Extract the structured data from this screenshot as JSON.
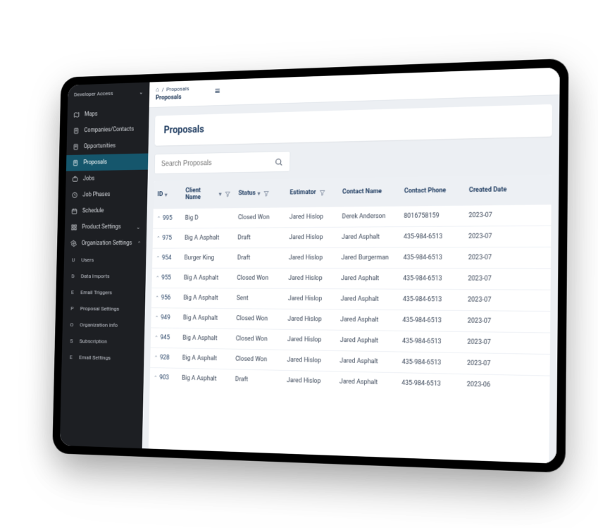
{
  "sidebar": {
    "header": {
      "label": "Developer Access"
    },
    "items": [
      {
        "key": "maps",
        "label": "Maps",
        "icon": "map"
      },
      {
        "key": "companies",
        "label": "Companies/Contacts",
        "icon": "doc"
      },
      {
        "key": "opportunities",
        "label": "Opportunities",
        "icon": "doc"
      },
      {
        "key": "proposals",
        "label": "Proposals",
        "icon": "doc",
        "active": true
      },
      {
        "key": "jobs",
        "label": "Jobs",
        "icon": "briefcase"
      },
      {
        "key": "jobphases",
        "label": "Job Phases",
        "icon": "clock"
      },
      {
        "key": "schedule",
        "label": "Schedule",
        "icon": "calendar"
      },
      {
        "key": "productsettings",
        "label": "Product Settings",
        "icon": "grid",
        "expandable": true,
        "expanded": false
      },
      {
        "key": "orgsettings",
        "label": "Organization Settings",
        "icon": "gear",
        "expandable": true,
        "expanded": true
      }
    ],
    "orgsubitems": [
      {
        "letter": "U",
        "label": "Users"
      },
      {
        "letter": "D",
        "label": "Data Imports"
      },
      {
        "letter": "E",
        "label": "Email Triggers"
      },
      {
        "letter": "P",
        "label": "Proposal Settings"
      },
      {
        "letter": "O",
        "label": "Organization Info"
      },
      {
        "letter": "S",
        "label": "Subscription"
      },
      {
        "letter": "E",
        "label": "Email Settings"
      }
    ]
  },
  "breadcrumb": {
    "item": "Proposals",
    "title": "Proposals"
  },
  "page": {
    "title": "Proposals"
  },
  "search": {
    "placeholder": "Search Proposals"
  },
  "table": {
    "headers": {
      "id": "ID",
      "client": "Client Name",
      "status": "Status",
      "estimator": "Estimator",
      "contact": "Contact Name",
      "phone": "Contact Phone",
      "date": "Created Date"
    },
    "rows": [
      {
        "id": "995",
        "client": "Big D",
        "status": "Closed Won",
        "estimator": "Jared Hislop",
        "contact": "Derek Anderson",
        "phone": "8016758159",
        "date": "2023-07"
      },
      {
        "id": "975",
        "client": "Big A Asphalt",
        "status": "Draft",
        "estimator": "Jared Hislop",
        "contact": "Jared Asphalt",
        "phone": "435-984-6513",
        "date": "2023-07"
      },
      {
        "id": "954",
        "client": "Burger King",
        "status": "Draft",
        "estimator": "Jared Hislop",
        "contact": "Jared Burgerman",
        "phone": "435-984-6513",
        "date": "2023-07"
      },
      {
        "id": "955",
        "client": "Big A Asphalt",
        "status": "Closed Won",
        "estimator": "Jared Hislop",
        "contact": "Jared Asphalt",
        "phone": "435-984-6513",
        "date": "2023-07"
      },
      {
        "id": "956",
        "client": "Big A Asphalt",
        "status": "Sent",
        "estimator": "Jared Hislop",
        "contact": "Jared Asphalt",
        "phone": "435-984-6513",
        "date": "2023-07"
      },
      {
        "id": "949",
        "client": "Big A Asphalt",
        "status": "Closed Won",
        "estimator": "Jared Hislop",
        "contact": "Jared Asphalt",
        "phone": "435-984-6513",
        "date": "2023-07"
      },
      {
        "id": "945",
        "client": "Big A Asphalt",
        "status": "Closed Won",
        "estimator": "Jared Hislop",
        "contact": "Jared Asphalt",
        "phone": "435-984-6513",
        "date": "2023-07"
      },
      {
        "id": "928",
        "client": "Big A Asphalt",
        "status": "Closed Won",
        "estimator": "Jared Hislop",
        "contact": "Jared Asphalt",
        "phone": "435-984-6513",
        "date": "2023-07"
      },
      {
        "id": "903",
        "client": "Big A Asphalt",
        "status": "Draft",
        "estimator": "Jared Hislop",
        "contact": "Jared Asphalt",
        "phone": "435-984-6513",
        "date": "2023-06"
      }
    ]
  }
}
